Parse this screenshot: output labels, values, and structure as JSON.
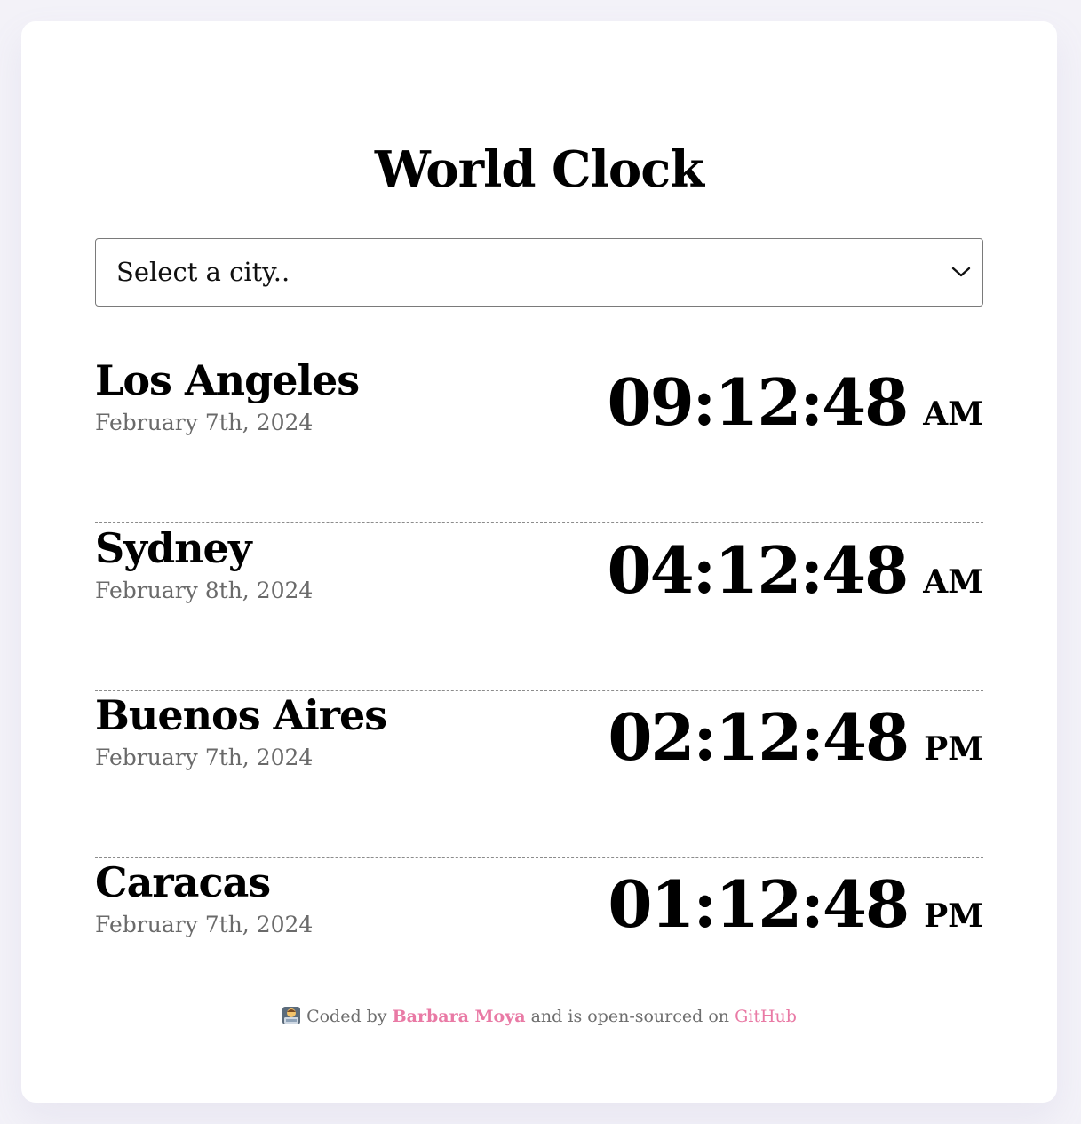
{
  "title": "World Clock",
  "select": {
    "selected": "Select a city.."
  },
  "cities": [
    {
      "name": "Los Angeles",
      "date": "February 7th, 2024",
      "time": "09:12:48",
      "ampm": "AM"
    },
    {
      "name": "Sydney",
      "date": "February 8th, 2024",
      "time": "04:12:48",
      "ampm": "AM"
    },
    {
      "name": "Buenos Aires",
      "date": "February 7th, 2024",
      "time": "02:12:48",
      "ampm": "PM"
    },
    {
      "name": "Caracas",
      "date": "February 7th, 2024",
      "time": "01:12:48",
      "ampm": "PM"
    }
  ],
  "footer": {
    "icon": "technologist-emoji-icon",
    "prefix": "Coded by",
    "author": "Barbara Moya",
    "middle": "and is open-sourced on",
    "repo_link": "GitHub",
    "link_color": "#e97aa5"
  }
}
